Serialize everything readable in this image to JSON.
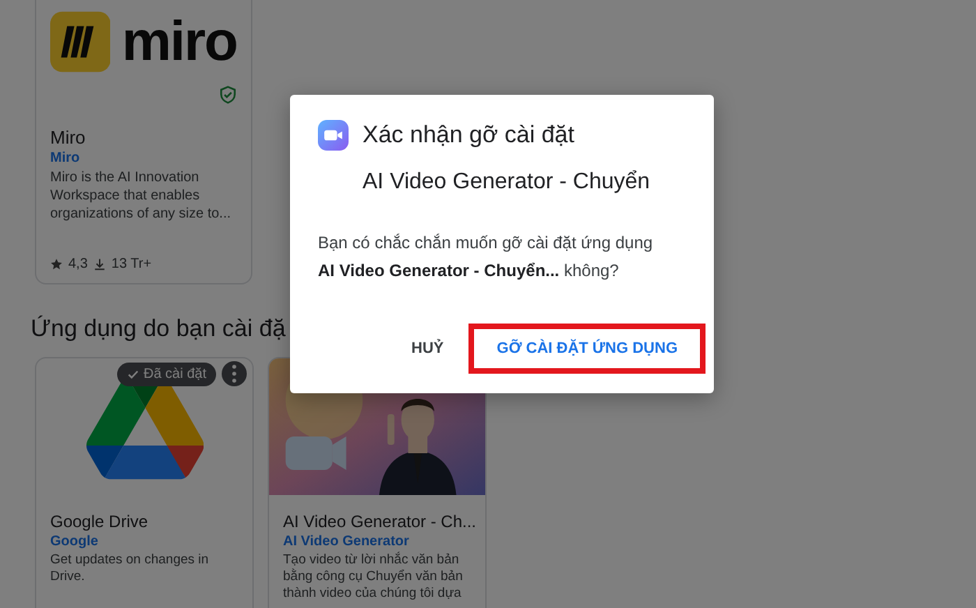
{
  "featured_app": {
    "logo_text": "miro",
    "name": "Miro",
    "developer": "Miro",
    "description": "Miro is the AI Innovation Workspace that enables organizations of any size to...",
    "rating": "4,3",
    "downloads": "13 Tr+"
  },
  "section_title": "Ứng dụng do bạn cài đặ",
  "installed_apps": [
    {
      "kind": "drive",
      "name": "Google Drive",
      "developer": "Google",
      "description": "Get updates on changes in Drive.",
      "badge": "Đã cài đặt"
    },
    {
      "kind": "picture",
      "name": "AI Video Generator - Ch...",
      "developer": "AI Video Generator",
      "description": "Tạo video từ lời nhắc văn bản bằng công cụ Chuyển văn bản thành video của chúng tôi dựa"
    }
  ],
  "dialog": {
    "title": "Xác nhận gỡ cài đặt",
    "app_name": "AI Video Generator - Chuyển",
    "message": "Bạn có chắc chắn muốn gỡ cài đặt ứng dụng **AI Video Generator - Chuyển...** không?",
    "buttons": [
      {
        "label": "HUỶ",
        "kind": "text",
        "highlighted": false
      },
      {
        "label": "GỠ CÀI ĐẶT ỨNG DỤNG",
        "kind": "primary",
        "highlighted": true
      }
    ]
  }
}
